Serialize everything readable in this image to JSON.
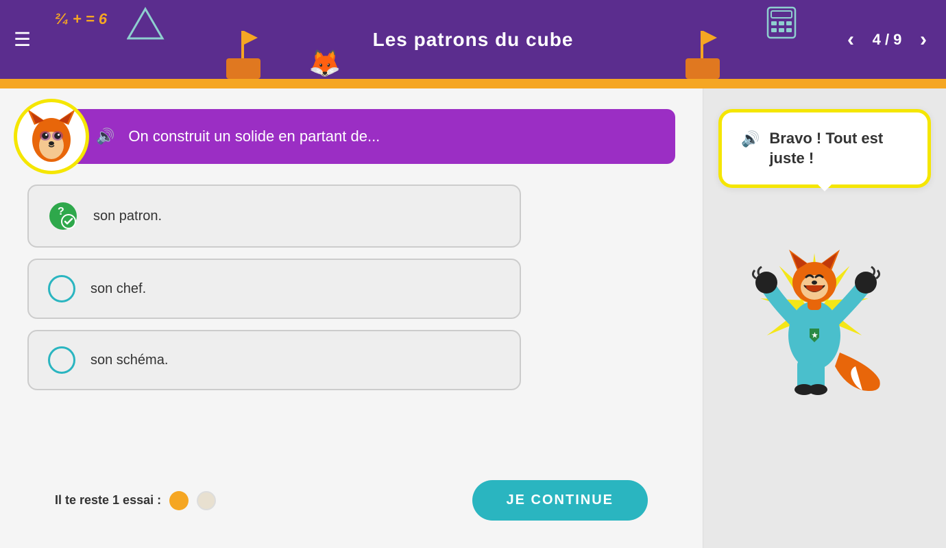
{
  "header": {
    "title": "Les patrons du cube",
    "hamburger": "☰",
    "deco_math": "²⁄₄ + = 6",
    "nav_prev": "‹",
    "nav_next": "›",
    "nav_current": "4",
    "nav_total": "9",
    "nav_display": "4 / 9"
  },
  "question": {
    "text": "On construit un solide en partant de...",
    "sound_icon": "🔊"
  },
  "answers": [
    {
      "id": "a1",
      "text": "son patron.",
      "state": "correct",
      "label": "answer-option-1"
    },
    {
      "id": "a2",
      "text": "son chef.",
      "state": "unselected",
      "label": "answer-option-2"
    },
    {
      "id": "a3",
      "text": "son schéma.",
      "state": "unselected",
      "label": "answer-option-3"
    }
  ],
  "bottom": {
    "attempts_label": "Il te reste 1 essai :",
    "continue_label": "JE CONTINUE",
    "attempts": [
      {
        "used": true
      },
      {
        "used": false
      }
    ]
  },
  "feedback": {
    "sound_icon": "🔊",
    "text_line1": "Bravo ! Tout est",
    "text_line2": "juste !",
    "text_full": "Bravo ! Tout est juste !"
  }
}
